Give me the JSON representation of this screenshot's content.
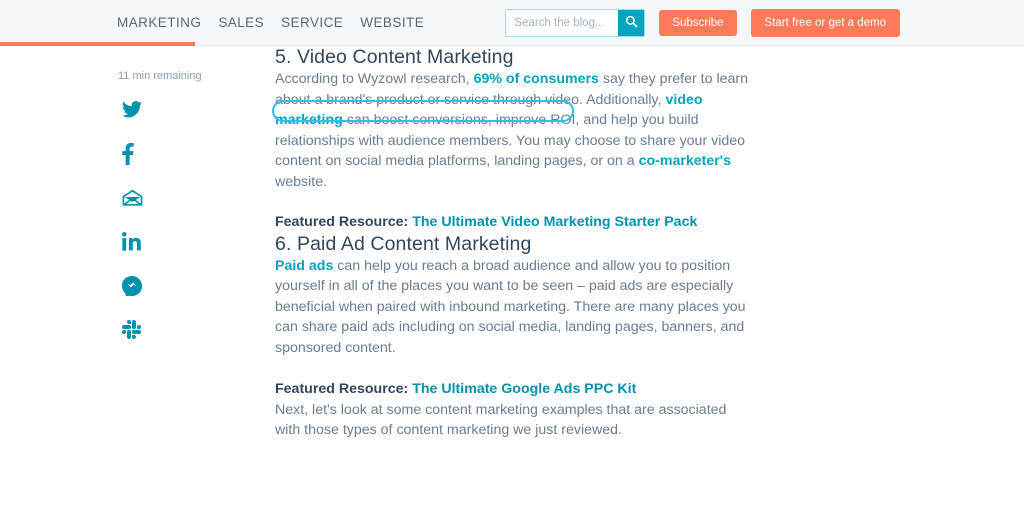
{
  "header": {
    "nav": [
      {
        "label": "MARKETING"
      },
      {
        "label": "SALES"
      },
      {
        "label": "SERVICE"
      },
      {
        "label": "WEBSITE"
      }
    ],
    "search": {
      "placeholder": "Search the blog...",
      "value": "",
      "icon": "search-icon"
    },
    "subscribe_label": "Subscribe",
    "demo_label": "Start free or get a demo",
    "brand_color": "#ff7a59",
    "accent_color": "#00a4bd",
    "background": "#f5f8fa"
  },
  "reading_progress": {
    "percent": 19,
    "color": "#ff7a59"
  },
  "sidebar": {
    "read_time": "11 min remaining",
    "share_items": [
      {
        "name": "twitter-icon",
        "label": "Twitter"
      },
      {
        "name": "facebook-icon",
        "label": "Facebook"
      },
      {
        "name": "email-icon",
        "label": "Email"
      },
      {
        "name": "linkedin-icon",
        "label": "LinkedIn"
      },
      {
        "name": "messenger-icon",
        "label": "Messenger"
      },
      {
        "name": "slack-icon",
        "label": "Slack"
      }
    ],
    "icon_color": "#0091ae"
  },
  "article": {
    "section5": {
      "heading": "5. Video Content Marketing",
      "para_part1": "According to Wyzowl research, ",
      "para_link1": "69% of consumers",
      "para_part2": " say they prefer to learn about a brand's product or service through video. Additionally, ",
      "para_link2": "video marketing",
      "para_part3": " can boost conversions, improve ROI, and help you build relationships with audience members. You may choose to share your video content on social media platforms, landing pages, or on a ",
      "para_link3": "co-marketer's",
      "para_part4": " website.",
      "featured_label": "Featured Resource: ",
      "featured_link": "The Ultimate Video Marketing Starter Pack"
    },
    "section6": {
      "heading": "6. Paid Ad Content Marketing",
      "para_link1": "Paid ads",
      "para_part1": " can help you reach a broad audience and allow you to position yourself in all of the places you want to be seen – paid ads are especially beneficial when paired with inbound marketing. There are many places you can share paid ads including on social media, landing pages, banners, and sponsored content.",
      "featured_label": "Featured Resource: ",
      "featured_link": "The Ultimate Google Ads PPC Kit"
    },
    "closing": "Next, let's look at some content marketing examples that are associated with those types of content marketing we just reviewed.",
    "text_color": "#6a7d91",
    "heading_color": "#33475b",
    "link_color": "#00a4bd"
  },
  "annotation": {
    "highlight_color": "#2ac2e8",
    "target_text": "According to Wyzowl research, 69% of consumers"
  }
}
